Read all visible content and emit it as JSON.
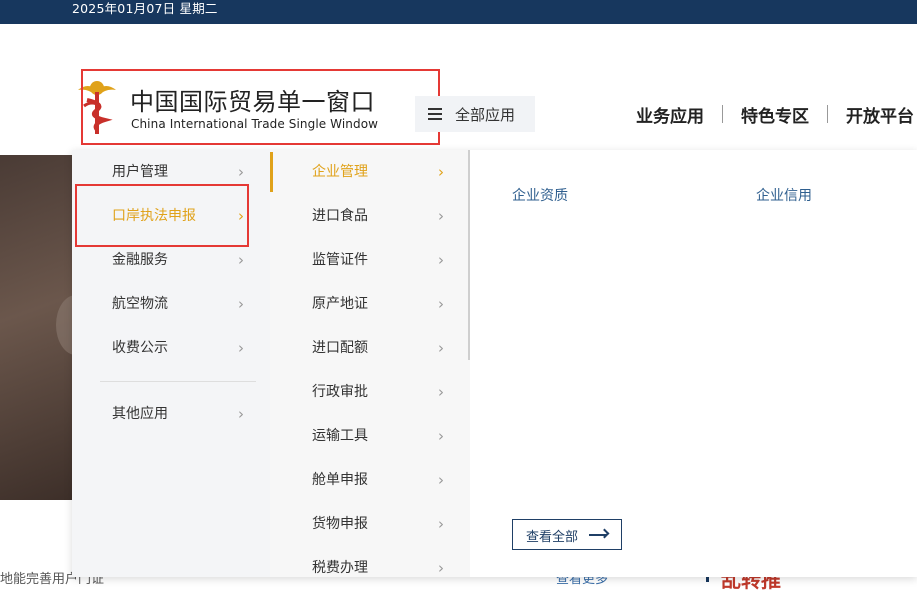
{
  "topbar": {
    "date": "2025年01月07日 星期二"
  },
  "header": {
    "logo_cn": "中国国际贸易单一窗口",
    "logo_en": "China International Trade Single Window",
    "all_apps_label": "全部应用",
    "nav": [
      "业务应用",
      "特色专区",
      "开放平台"
    ]
  },
  "menu": {
    "col1": [
      {
        "label": "用户管理"
      },
      {
        "label": "口岸执法申报",
        "active": true
      },
      {
        "label": "金融服务"
      },
      {
        "label": "航空物流"
      },
      {
        "label": "收费公示"
      },
      {
        "label": "其他应用"
      }
    ],
    "col2": [
      {
        "label": "企业管理",
        "active": true
      },
      {
        "label": "进口食品"
      },
      {
        "label": "监管证件"
      },
      {
        "label": "原产地证"
      },
      {
        "label": "进口配额"
      },
      {
        "label": "行政审批"
      },
      {
        "label": "运输工具"
      },
      {
        "label": "舱单申报"
      },
      {
        "label": "货物申报"
      },
      {
        "label": "税费办理"
      }
    ],
    "col3": {
      "links": [
        "企业资质",
        "企业信用"
      ],
      "view_all": "查看全部"
    }
  },
  "page_bottom": {
    "left_text": "地能完善用户门证",
    "link_text": "查看更多",
    "red_text": "乱转推"
  },
  "colors": {
    "topbar": "#17375e",
    "accent": "#e0a21a",
    "highlight_box": "#e53935",
    "link": "#2f5f8f"
  },
  "icons": {
    "chevron": "chevron-right-icon",
    "menu": "hamburger-icon",
    "arrow": "arrow-right-icon",
    "logo": "caduceus-emblem-icon"
  }
}
